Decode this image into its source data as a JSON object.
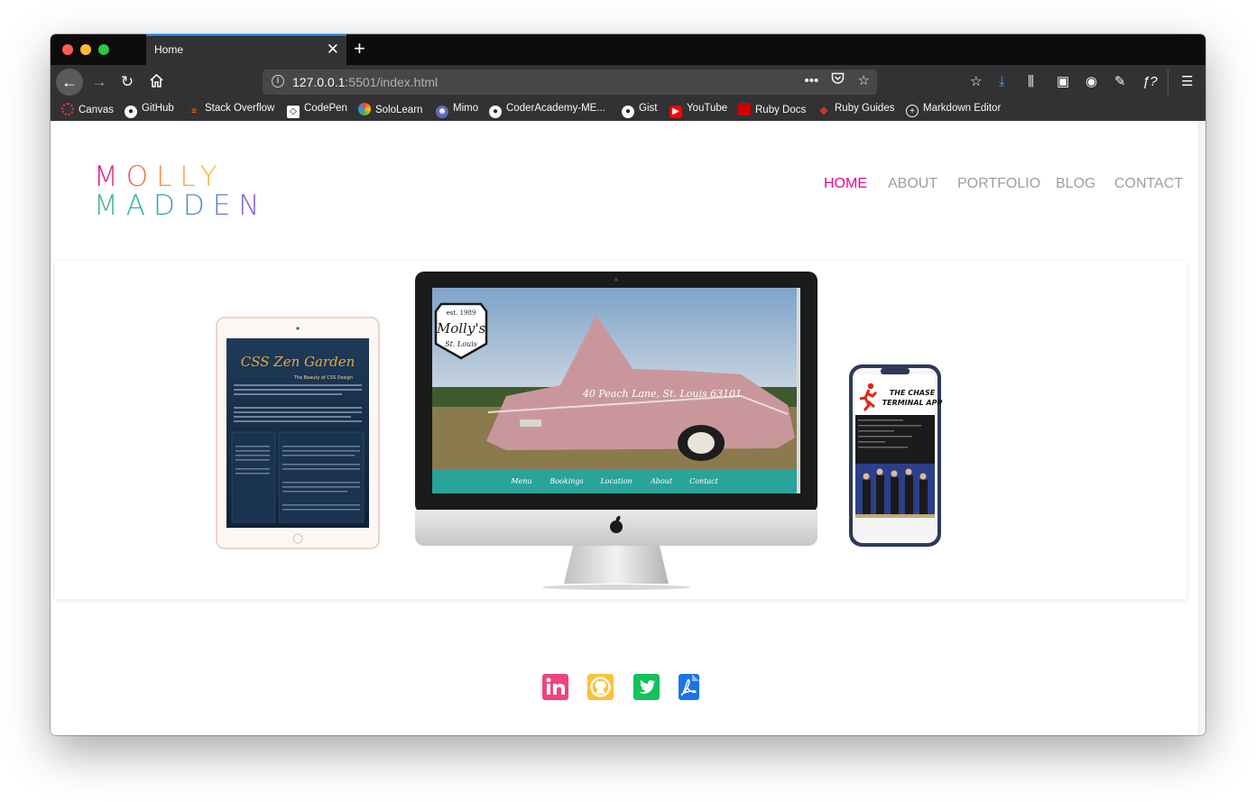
{
  "browser": {
    "tab_title": "Home",
    "tab_close": "✕",
    "new_tab": "+",
    "url_host": "127.0.0.1",
    "url_rest": ":5501/index.html",
    "url_more": "•••",
    "icons": {
      "back": "back-arrow-icon",
      "forward": "forward-arrow-icon",
      "reload": "reload-icon",
      "home": "home-icon",
      "pocket": "pocket-icon",
      "bookmark_star": "bookmark-star-icon",
      "menu": "hamburger-menu-icon"
    }
  },
  "bookmarks": [
    {
      "label": "Canvas",
      "color": "#e13b26"
    },
    {
      "label": "GitHub",
      "color": "#24292e"
    },
    {
      "label": "Stack Overflow",
      "color": "#f48024"
    },
    {
      "label": "CodePen",
      "color": "#111111"
    },
    {
      "label": "SoloLearn",
      "color": "#8bc34a"
    },
    {
      "label": "Mimo",
      "color": "#5c6bc0"
    },
    {
      "label": "CoderAcademy-ME...",
      "color": "#24292e"
    },
    {
      "label": "Gist",
      "color": "#24292e"
    },
    {
      "label": "YouTube",
      "color": "#ff0000"
    },
    {
      "label": "Ruby Docs",
      "color": "#cc0000"
    },
    {
      "label": "Ruby Guides",
      "color": "#cc342d"
    },
    {
      "label": "Markdown Editor",
      "color": "#777777"
    }
  ],
  "site": {
    "logo_line1": "MOLLY",
    "logo_line2": "MADDEN",
    "nav": [
      "HOME",
      "ABOUT",
      "PORTFOLIO",
      "BLOG",
      "CONTACT"
    ],
    "active_nav": "HOME",
    "accent": "#e8078c",
    "hero": {
      "tablet": {
        "title": "CSS Zen Garden",
        "subtitle": "The Beauty of CSS Design"
      },
      "desktop": {
        "badge_est": "est. 1989",
        "badge_name": "Molly's",
        "badge_city": "St. Louis",
        "address": "40 Peach Lane, St. Louis 63101",
        "menu": [
          "Menu",
          "Bookings",
          "Location",
          "About",
          "Contact"
        ]
      },
      "phone": {
        "title_line1": "THE CHASE",
        "title_line2": "TERMINAL APP"
      }
    },
    "social": [
      {
        "name": "linkedin",
        "glyph": "in",
        "color": "#f0447d"
      },
      {
        "name": "github",
        "glyph": "",
        "color": "#f9c13c"
      },
      {
        "name": "twitter",
        "glyph": "",
        "color": "#12c25d"
      },
      {
        "name": "pdf",
        "glyph": "",
        "color": "#1a73e8"
      }
    ]
  }
}
